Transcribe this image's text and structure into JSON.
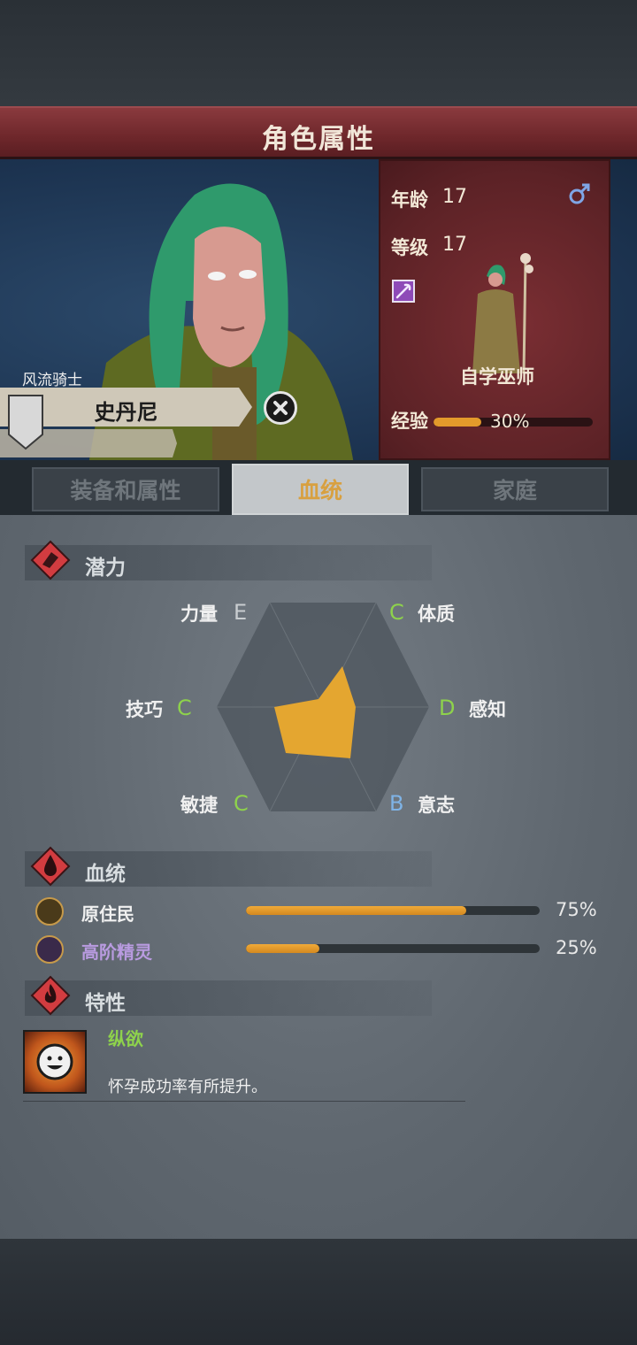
{
  "header": {
    "title": "角色属性"
  },
  "character": {
    "nickname": "风流骑士",
    "name": "史丹尼",
    "age_label": "年龄",
    "age": "17",
    "level_label": "等级",
    "level": "17",
    "class_name": "自学巫师",
    "exp_label": "经验",
    "exp_percent": "30%",
    "exp_fraction": 0.3,
    "gender_icon": "male-icon"
  },
  "tabs": [
    {
      "label": "装备和属性"
    },
    {
      "label": "血统"
    },
    {
      "label": "家庭"
    }
  ],
  "active_tab": 1,
  "potential": {
    "title": "潜力",
    "stats": [
      {
        "label": "力量",
        "grade": "E"
      },
      {
        "label": "体质",
        "grade": "C"
      },
      {
        "label": "感知",
        "grade": "D"
      },
      {
        "label": "意志",
        "grade": "B"
      },
      {
        "label": "敏捷",
        "grade": "C"
      },
      {
        "label": "技巧",
        "grade": "C"
      }
    ]
  },
  "bloodline": {
    "title": "血统",
    "items": [
      {
        "name": "原住民",
        "percent": "75%",
        "fraction": 0.75,
        "name_color": "#f0f0f0"
      },
      {
        "name": "高阶精灵",
        "percent": "25%",
        "fraction": 0.25,
        "name_color": "#b99be0"
      }
    ]
  },
  "traits": {
    "title": "特性",
    "items": [
      {
        "name": "纵欲",
        "description": "怀孕成功率有所提升。"
      }
    ]
  },
  "colors": {
    "accent_orange": "#e39a2b",
    "title_red": "#6e272b",
    "grade_green": "#8ed24c",
    "grade_blue": "#7fb3e6",
    "grade_gray": "#c9cdd0"
  }
}
